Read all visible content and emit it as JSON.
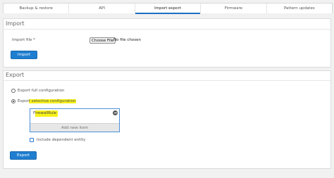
{
  "tabs": [
    {
      "label": "Backup & restore"
    },
    {
      "label": "API"
    },
    {
      "label": "Import export"
    },
    {
      "label": "Firmware"
    },
    {
      "label": "Pattern updates"
    }
  ],
  "active_tab": "Import export",
  "import": {
    "title": "Import",
    "file_label": "Import file *",
    "choose_file_label": "Choose File",
    "no_file_text": "No file chosen",
    "import_button": "Import"
  },
  "export": {
    "title": "Export",
    "option_full": "Export full configuration",
    "option_selective_prefix": "Expor",
    "option_selective_highlight": "t selective configuration",
    "list_item_prefix": "F",
    "list_item_highlight": "irewallRule",
    "add_new_item": "Add new item",
    "include_dependent": "Include dependent entity",
    "export_button": "Export"
  },
  "colors": {
    "accent": "#1f7ed0",
    "highlight": "#f7f21a"
  }
}
